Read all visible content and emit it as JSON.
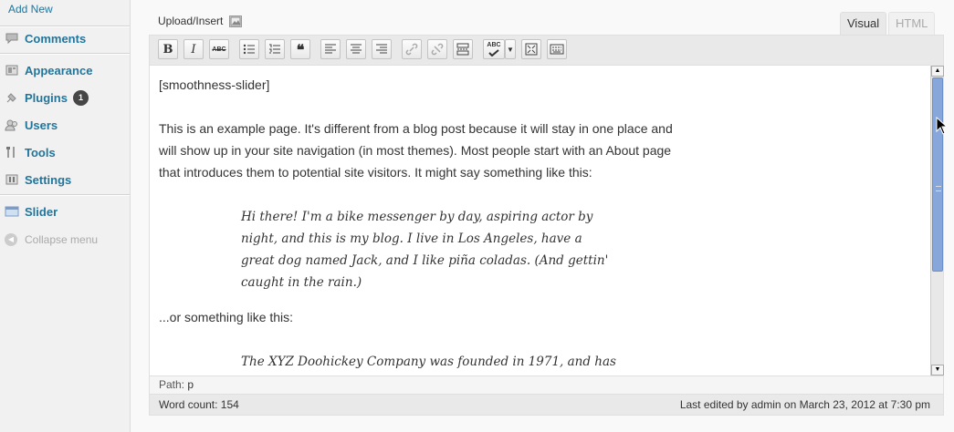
{
  "sidebar": {
    "add_new": "Add New",
    "items": [
      {
        "label": "Comments",
        "icon": "comments-icon"
      },
      {
        "label": "Appearance",
        "icon": "appearance-icon"
      },
      {
        "label": "Plugins",
        "icon": "plugins-icon",
        "badge": "1"
      },
      {
        "label": "Users",
        "icon": "users-icon"
      },
      {
        "label": "Tools",
        "icon": "tools-icon"
      },
      {
        "label": "Settings",
        "icon": "settings-icon"
      },
      {
        "label": "Slider",
        "icon": "slider-icon"
      }
    ],
    "collapse_label": "Collapse menu"
  },
  "editor": {
    "upload_insert": "Upload/Insert",
    "tabs": {
      "visual": "Visual",
      "html": "HTML"
    },
    "toolbar": {
      "bold": "B",
      "italic": "I",
      "strikethrough": "ABC",
      "spellcheck": "ABC"
    },
    "content": {
      "shortcode": "[smoothness-slider]",
      "para1": "This is an example page. It's different from a blog post because it will stay in one place and will show up in your site navigation (in most themes). Most people start with an About page that introduces them to potential site visitors. It might say something like this:",
      "quote1": "Hi there! I'm a bike messenger by day, aspiring actor by night, and this is my blog. I live in Los Angeles, have a great dog named Jack, and I like piña coladas. (And gettin' caught in the rain.)",
      "para2": "...or something like this:",
      "quote2": "The XYZ Doohickey Company was founded in 1971, and has"
    },
    "path_label": "Path:",
    "path_value": "p",
    "word_count": "Word count: 154",
    "last_edited": "Last edited by admin on March 23, 2012 at 7:30 pm"
  },
  "colors": {
    "link": "#21759b",
    "scroll_thumb": "#87a7db",
    "badge": "#464646"
  }
}
